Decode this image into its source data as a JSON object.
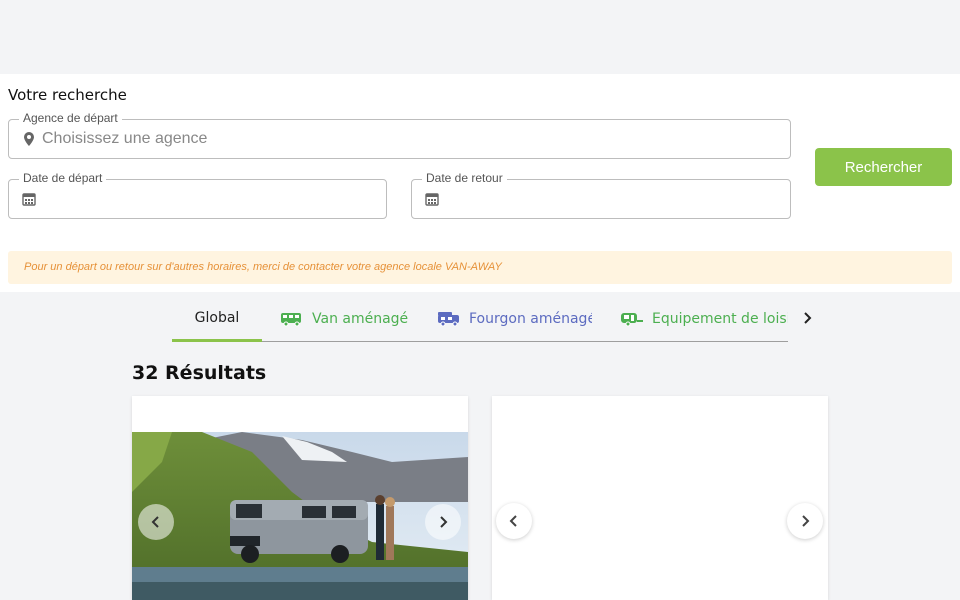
{
  "search": {
    "title": "Votre recherche",
    "agency_label": "Agence de départ",
    "agency_placeholder": "Choisissez une agence",
    "departure_label": "Date de départ",
    "return_label": "Date de retour",
    "button_label": "Rechercher"
  },
  "notice": {
    "text": "Pour un départ ou retour sur d'autres horaires, merci de contacter votre agence locale VAN-AWAY"
  },
  "tabs": [
    {
      "label": "Global",
      "icon": "",
      "active": true
    },
    {
      "label": "Van aménagé",
      "icon": "van-icon",
      "active": false
    },
    {
      "label": "Fourgon aménagé",
      "icon": "camper-icon",
      "active": false
    },
    {
      "label": "Equipement de loisi",
      "icon": "trailer-icon",
      "active": false
    }
  ],
  "results": {
    "count_label": "32 Résultats"
  },
  "colors": {
    "accent_green": "#8bc34a",
    "tab_green": "#4caf50",
    "tab_blue": "#5c6bc0",
    "notice_bg": "#fff4e0",
    "notice_text": "#e69138"
  }
}
